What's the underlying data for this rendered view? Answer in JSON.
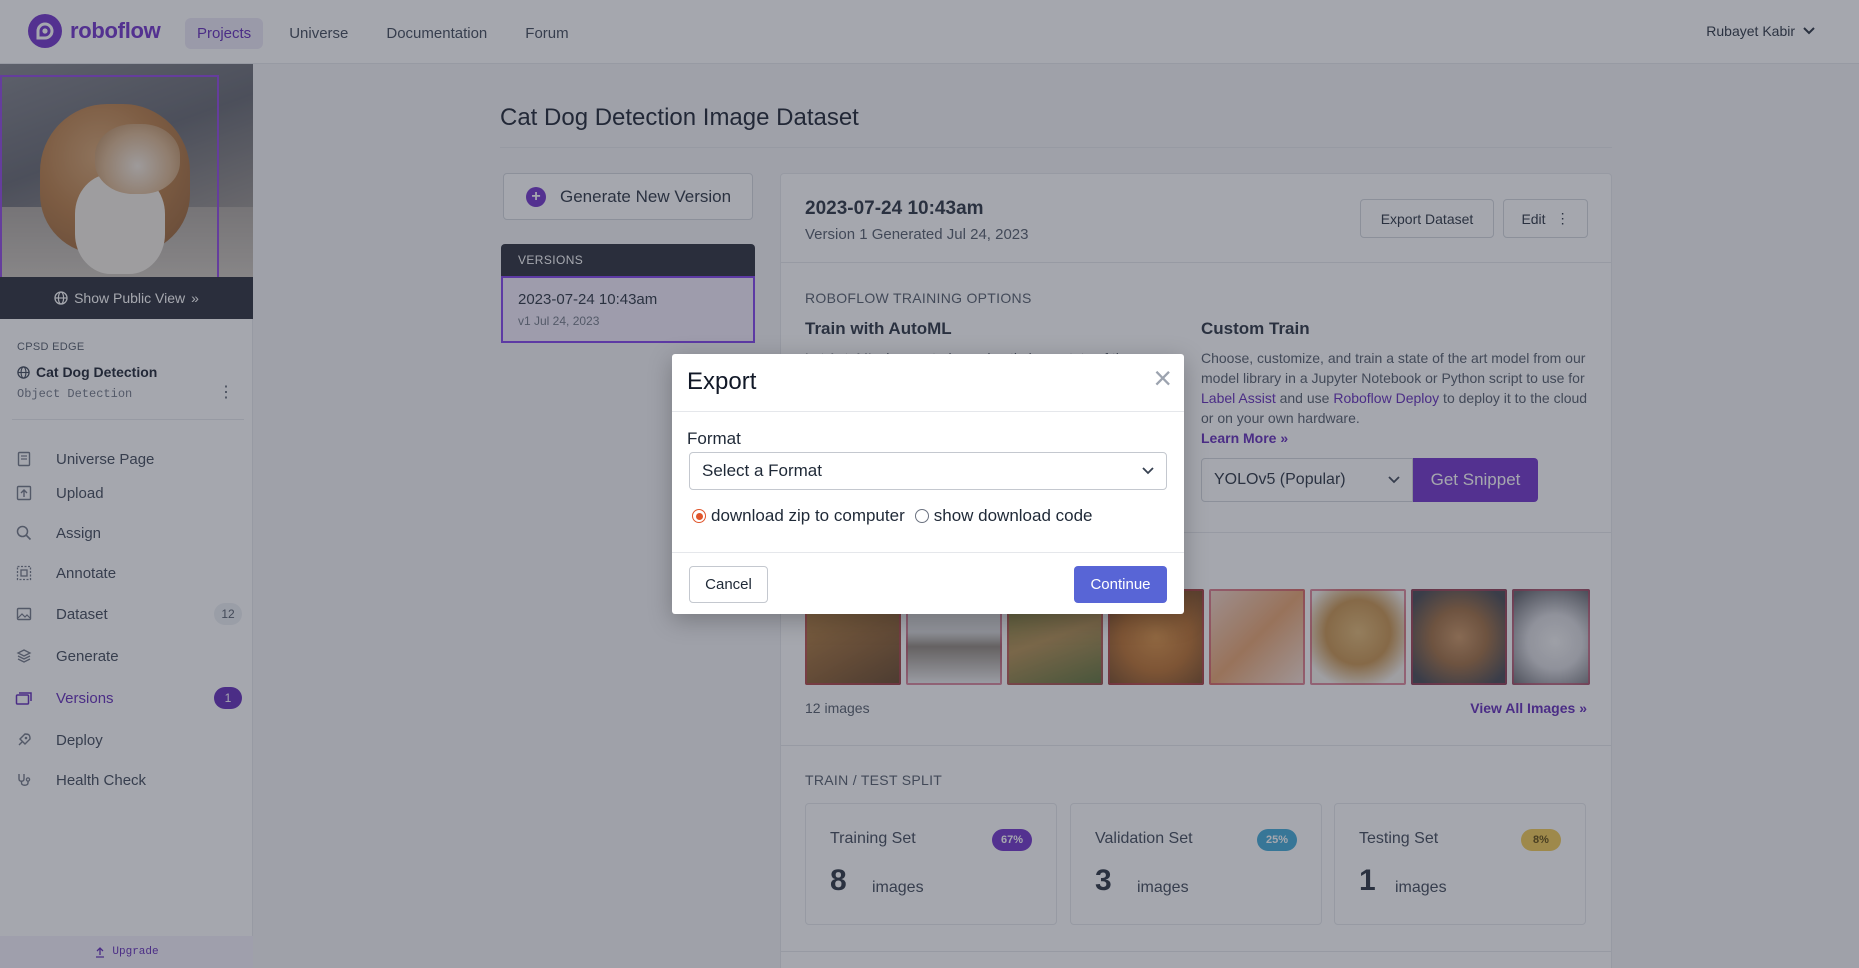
{
  "brand": {
    "name": "roboflow"
  },
  "nav": {
    "items": [
      {
        "label": "Projects"
      },
      {
        "label": "Universe"
      },
      {
        "label": "Documentation"
      },
      {
        "label": "Forum"
      }
    ],
    "user": "Rubayet Kabir"
  },
  "sidebar": {
    "public_view": "Show Public View",
    "workspace": "CPSD EDGE",
    "project_name": "Cat Dog Detection",
    "project_type": "Object Detection",
    "items": [
      {
        "label": "Universe Page",
        "icon": "universe-page-icon"
      },
      {
        "label": "Upload",
        "icon": "upload-icon"
      },
      {
        "label": "Assign",
        "icon": "search-icon"
      },
      {
        "label": "Annotate",
        "icon": "annotate-icon"
      },
      {
        "label": "Dataset",
        "icon": "dataset-icon",
        "badge": "12"
      },
      {
        "label": "Generate",
        "icon": "generate-icon"
      },
      {
        "label": "Versions",
        "icon": "versions-icon",
        "badge": "1"
      },
      {
        "label": "Deploy",
        "icon": "deploy-icon"
      },
      {
        "label": "Health Check",
        "icon": "health-check-icon"
      }
    ],
    "upgrade": "Upgrade"
  },
  "main": {
    "title": "Cat Dog Detection Image Dataset",
    "generate_button": "Generate New Version",
    "versions": {
      "header": "VERSIONS",
      "items": [
        {
          "title": "2023-07-24 10:43am",
          "sub": "v1 Jul 24, 2023"
        }
      ]
    },
    "version": {
      "title": "2023-07-24 10:43am",
      "subtitle": "Version 1 Generated Jul 24, 2023",
      "export_button": "Export Dataset",
      "edit_button": "Edit"
    },
    "training": {
      "section_label": "ROBOFLOW TRAINING OPTIONS",
      "automl_title": "Train with AutoML",
      "automl_desc": "Let AutoML choose, train, and optimize a state of the",
      "custom_title": "Custom Train",
      "custom_desc_1": "Choose, customize, and train a state of the art model from our model library in a Jupyter Notebook or Python script to use for ",
      "custom_link_1": "Label Assist",
      "custom_desc_2": " and use ",
      "custom_link_2": "Roboflow Deploy",
      "custom_desc_3": " to deploy it to the cloud or on your own hardware.",
      "learn_more": "Learn More",
      "model_value": "YOLOv5 (Popular)",
      "snippet_button": "Get Snippet"
    },
    "images": {
      "count": "12 images",
      "view_all": "View All Images"
    },
    "split": {
      "section_label": "TRAIN / TEST SPLIT",
      "sets": [
        {
          "name": "Training Set",
          "pct": "67%",
          "count": "8",
          "unit": "images",
          "color": "#6a28c8"
        },
        {
          "name": "Validation Set",
          "pct": "25%",
          "count": "3",
          "unit": "images",
          "color": "#38a6d6"
        },
        {
          "name": "Testing Set",
          "pct": "8%",
          "count": "1",
          "unit": "images",
          "color": "#f2c94c"
        }
      ]
    }
  },
  "modal": {
    "title": "Export",
    "format_label": "Format",
    "format_placeholder": "Select a Format",
    "option_zip": "download zip to computer",
    "option_code": "show download code",
    "selected_option": "download zip to computer",
    "cancel": "Cancel",
    "continue": "Continue"
  },
  "colors": {
    "brand": "#6a28c8",
    "continue_button": "#5865d6",
    "radio_selected": "#e0552b"
  }
}
